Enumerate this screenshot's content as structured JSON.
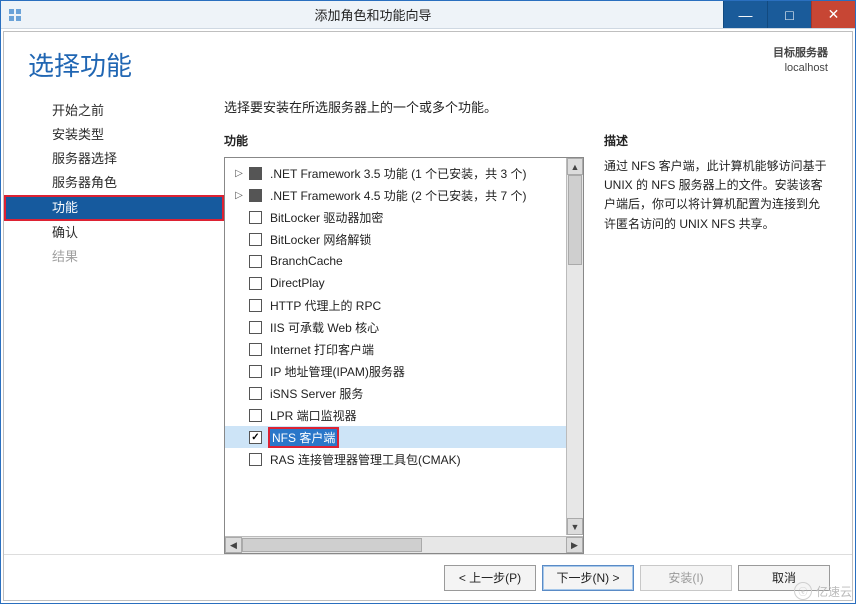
{
  "window": {
    "title": "添加角色和功能向导",
    "min_btn": "—",
    "max_btn": "□",
    "close_btn": "✕"
  },
  "header": {
    "page_title": "选择功能",
    "target_label": "目标服务器",
    "target_value": "localhost"
  },
  "sidebar": {
    "items": [
      {
        "label": "开始之前"
      },
      {
        "label": "安装类型"
      },
      {
        "label": "服务器选择"
      },
      {
        "label": "服务器角色"
      },
      {
        "label": "功能",
        "active": true
      },
      {
        "label": "确认"
      },
      {
        "label": "结果",
        "disabled": true
      }
    ]
  },
  "main": {
    "instruction": "选择要安装在所选服务器上的一个或多个功能。",
    "features_label": "功能",
    "description_label": "描述",
    "description_text": "通过 NFS 客户端，此计算机能够访问基于 UNIX 的 NFS 服务器上的文件。安装该客户端后，你可以将计算机配置为连接到允许匿名访问的 UNIX NFS 共享。",
    "features": [
      {
        "label": ".NET Framework 3.5 功能 (1 个已安装，共 3 个)",
        "expandable": true,
        "state": "partial"
      },
      {
        "label": ".NET Framework 4.5 功能 (2 个已安装，共 7 个)",
        "expandable": true,
        "state": "partial"
      },
      {
        "label": "BitLocker 驱动器加密",
        "state": "unchecked"
      },
      {
        "label": "BitLocker 网络解锁",
        "state": "unchecked"
      },
      {
        "label": "BranchCache",
        "state": "unchecked"
      },
      {
        "label": "DirectPlay",
        "state": "unchecked"
      },
      {
        "label": "HTTP 代理上的 RPC",
        "state": "unchecked"
      },
      {
        "label": "IIS 可承载 Web 核心",
        "state": "unchecked"
      },
      {
        "label": "Internet 打印客户端",
        "state": "unchecked"
      },
      {
        "label": "IP 地址管理(IPAM)服务器",
        "state": "unchecked"
      },
      {
        "label": "iSNS Server 服务",
        "state": "unchecked"
      },
      {
        "label": "LPR 端口监视器",
        "state": "unchecked"
      },
      {
        "label": "NFS 客户端",
        "state": "checked",
        "selected": true
      },
      {
        "label": "RAS 连接管理器管理工具包(CMAK)",
        "state": "unchecked"
      }
    ]
  },
  "footer": {
    "prev": "< 上一步(P)",
    "next": "下一步(N) >",
    "install": "安装(I)",
    "cancel": "取消"
  },
  "watermark": "亿速云"
}
